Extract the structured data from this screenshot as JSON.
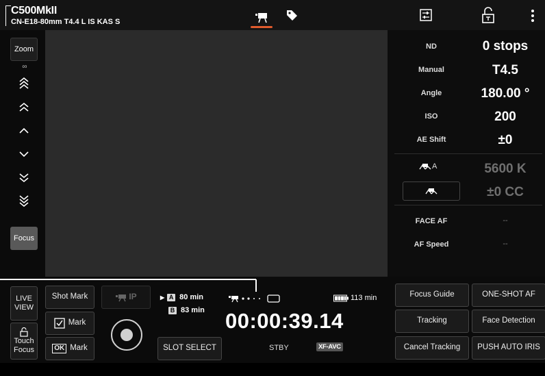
{
  "header": {
    "camera_model": "C500MkII",
    "lens": "CN-E18-80mm T4.4 L IS KAS S",
    "icons": [
      "camera-mode-icon",
      "tag-icon",
      "settings-sliders-icon",
      "unlock-icon",
      "more-vertical-icon"
    ],
    "accent_color": "#e05a2c"
  },
  "left_strip": {
    "zoom_label": "Zoom",
    "infinity": "∞",
    "focus_label": "Focus"
  },
  "right_panel": {
    "nd_label": "ND",
    "nd_value": "0 stops",
    "iris_label": "Manual",
    "iris_value": "T4.5",
    "angle_label": "Angle",
    "angle_value": "180.00 °",
    "iso_label": "ISO",
    "iso_value": "200",
    "ae_label": "AE Shift",
    "ae_value": "±0",
    "wb_a_label": "A",
    "wb_kelvin": "5600 K",
    "wb_cc": "±0 CC",
    "face_af_label": "FACE AF",
    "face_af_value": "--",
    "af_speed_label": "AF Speed",
    "af_speed_value": "--"
  },
  "bottom": {
    "live_view": "LIVE\nVIEW",
    "touch_focus": "Touch\nFocus",
    "shot_mark": "Shot Mark",
    "check_mark": "Mark",
    "ok_mark": "Mark",
    "ok_label": "OK",
    "ip_label": "IP",
    "slot_a_letter": "A",
    "slot_a_time": "80 min",
    "slot_b_letter": "B",
    "slot_b_time": "83 min",
    "slot_select": "SLOT SELECT",
    "battery_time": "113 min",
    "timecode": "00:00:39.14",
    "status": "STBY",
    "codec": "XF-AVC",
    "focus_guide": "Focus Guide",
    "one_shot_af": "ONE-SHOT AF",
    "tracking": "Tracking",
    "face_detection": "Face Detection",
    "cancel_tracking": "Cancel Tracking",
    "push_auto_iris": "PUSH AUTO IRIS"
  }
}
